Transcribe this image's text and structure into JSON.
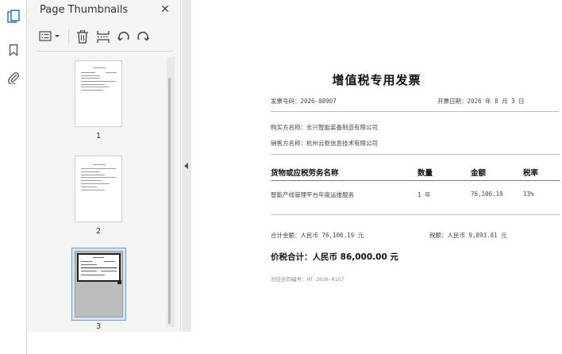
{
  "panel": {
    "title": "Page Thumbnails",
    "close_glyph": "✕",
    "thumbnails": [
      {
        "label": "1"
      },
      {
        "label": "2"
      },
      {
        "label": "3"
      }
    ]
  },
  "rail": {
    "items": [
      {
        "icon": "page-thumbnails-icon"
      },
      {
        "icon": "bookmark-icon"
      },
      {
        "icon": "attachment-icon"
      }
    ]
  },
  "colors": {
    "rail_active": "#2f7fd6",
    "selection": "#d7e6f5",
    "selection_border": "#6fa0d0"
  },
  "document": {
    "title": "增值税专用发票",
    "invoice_no": "发票号码：2026-08907",
    "issue_date": "开票日期：2026 年 8 月 3 日",
    "buyer": "购买方名称：长兴智能装备制造有限公司",
    "seller": "销售方名称：杭州云枢信息技术有限公司",
    "table": {
      "headers": [
        "货物或应税劳务名称",
        "数量",
        "金额",
        "税率"
      ],
      "rows": [
        [
          "智能产线管理平台年度运维服务",
          "1 年",
          "76,106.19",
          "13%"
        ]
      ]
    },
    "subtotal": "合计金额：人民币 76,106.19 元",
    "tax": "税额：人民币 9,893.81 元",
    "total": "价税合计：人民币 86,000.00 元",
    "contract_no": "对应合同编号：HT-2026-0157"
  }
}
